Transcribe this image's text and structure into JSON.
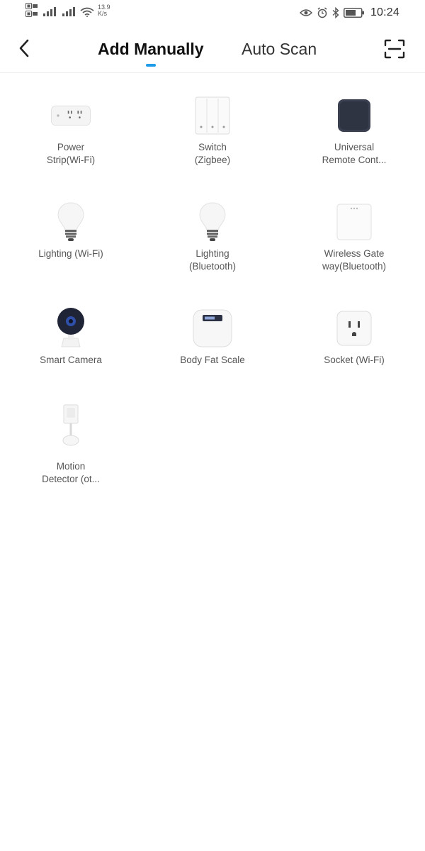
{
  "status_bar": {
    "sim1": "SIM1",
    "sim2": "SIM2",
    "network_speed_value": "13.9",
    "network_speed_unit": "K/s",
    "time": "10:24"
  },
  "header": {
    "tabs": [
      {
        "label": "Add Manually",
        "active": true
      },
      {
        "label": "Auto Scan",
        "active": false
      }
    ],
    "accent_color": "#1e9ce8"
  },
  "devices": [
    {
      "line1": "Power",
      "line2": "Strip(Wi-Fi)",
      "icon": "power-strip-icon"
    },
    {
      "line1": "Switch",
      "line2": "(Zigbee)",
      "icon": "wall-switch-icon"
    },
    {
      "line1": "Universal",
      "line2": "Remote Cont...",
      "icon": "universal-remote-icon"
    },
    {
      "line1": "Lighting (Wi-Fi)",
      "line2": "",
      "icon": "light-bulb-icon"
    },
    {
      "line1": "Lighting",
      "line2": "(Bluetooth)",
      "icon": "light-bulb-icon"
    },
    {
      "line1": "Wireless Gate",
      "line2": "way(Bluetooth)",
      "icon": "gateway-icon"
    },
    {
      "line1": "Smart Camera",
      "line2": "",
      "icon": "camera-icon"
    },
    {
      "line1": "Body Fat Scale",
      "line2": "",
      "icon": "scale-icon"
    },
    {
      "line1": "Socket (Wi-Fi)",
      "line2": "",
      "icon": "socket-icon"
    },
    {
      "line1": "Motion",
      "line2": "Detector (ot...",
      "icon": "motion-sensor-icon"
    }
  ]
}
